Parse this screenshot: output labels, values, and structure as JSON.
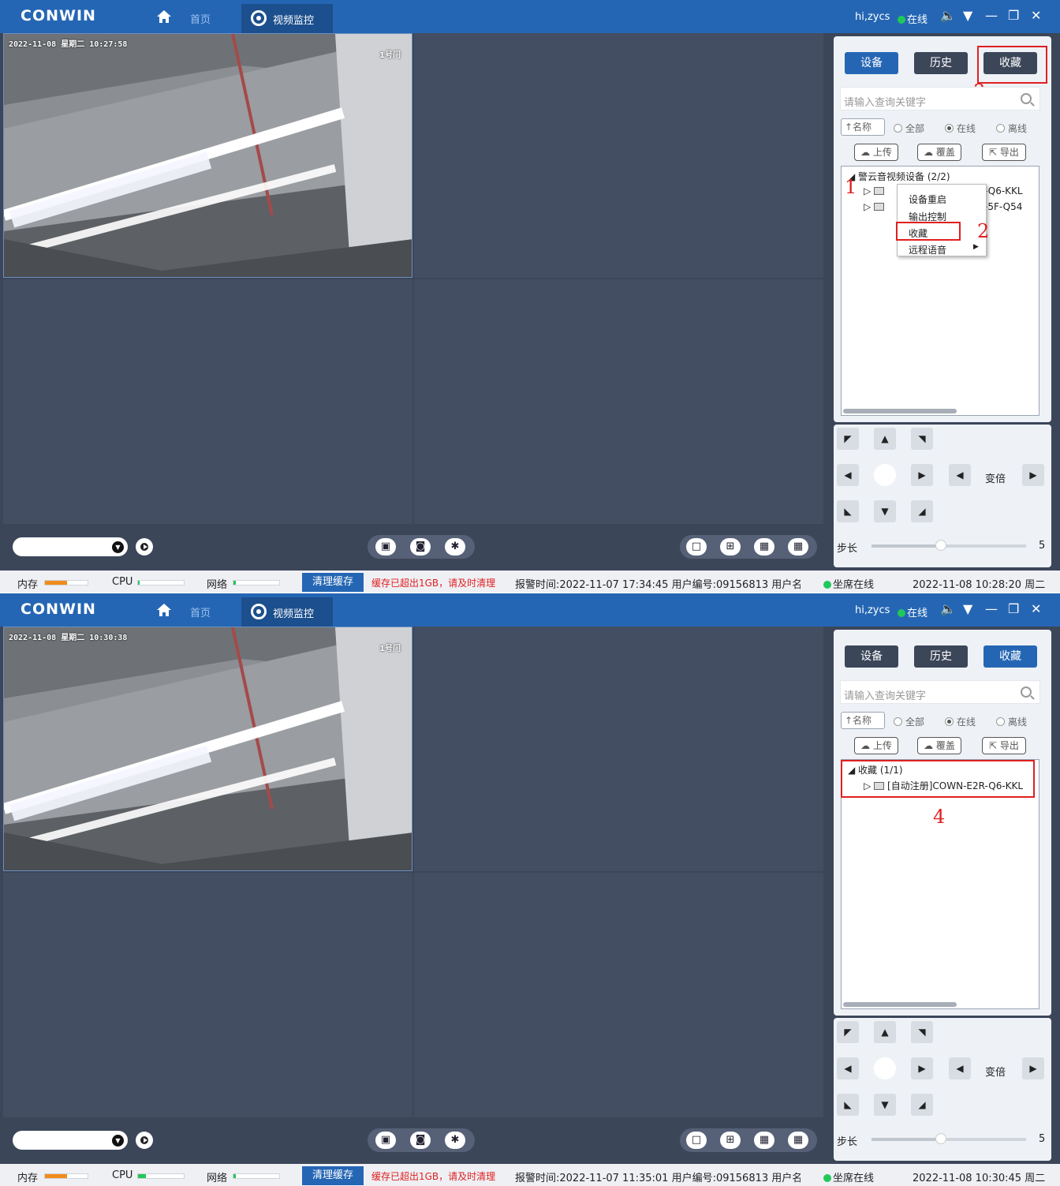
{
  "screens": [
    {
      "title": {
        "logo": "CONWIN",
        "home": "首页",
        "active_tab": "视频监控",
        "user": "hi,zycs",
        "status": "在线"
      },
      "video": {
        "osd": "2022-11-08 星期二 10:27:58",
        "osd_right": "1号门"
      },
      "panel": {
        "tabs": [
          "设备",
          "历史",
          "收藏"
        ],
        "active_tab_index": 0,
        "search_placeholder": "请输入查询关键字",
        "sort": "↑名称",
        "radios": [
          "全部",
          "在线",
          "离线"
        ],
        "radio_selected": 1,
        "actions": [
          "上传",
          "覆盖",
          "导出"
        ],
        "tree_root": "警云音视频设备 (2/2)",
        "tree_items": [
          "-Q6-KKL",
          "-5F-Q54"
        ],
        "context_menu": [
          "设备重启",
          "输出控制",
          "收藏",
          "远程语音"
        ],
        "annotations": [
          "1",
          "2",
          "3"
        ]
      },
      "ptz": {
        "zoom": "变倍",
        "step_label": "步长",
        "step_value": "5",
        "step_fraction": 0.45
      },
      "statusbar": {
        "mem": "内存",
        "cpu": "CPU",
        "net": "网络",
        "clear": "清理缓存",
        "warn": "缓存已超出1GB，请及时清理",
        "alarm": "报警时间:2022-11-07 17:34:45  用户编号:09156813  用户名",
        "seat": "坐席在线",
        "datetime": "2022-11-08 10:28:20 周二"
      }
    },
    {
      "title": {
        "logo": "CONWIN",
        "home": "首页",
        "active_tab": "视频监控",
        "user": "hi,zycs",
        "status": "在线"
      },
      "video": {
        "osd": "2022-11-08 星期二 10:30:38",
        "osd_right": "1号门"
      },
      "panel": {
        "tabs": [
          "设备",
          "历史",
          "收藏"
        ],
        "active_tab_index": 2,
        "search_placeholder": "请输入查询关键字",
        "sort": "↑名称",
        "radios": [
          "全部",
          "在线",
          "离线"
        ],
        "radio_selected": 1,
        "actions": [
          "上传",
          "覆盖",
          "导出"
        ],
        "tree_root": "收藏 (1/1)",
        "tree_items": [
          "[自动注册]COWN-E2R-Q6-KKL"
        ],
        "annotations": [
          "4"
        ]
      },
      "ptz": {
        "zoom": "变倍",
        "step_label": "步长",
        "step_value": "5",
        "step_fraction": 0.45
      },
      "statusbar": {
        "mem": "内存",
        "cpu": "CPU",
        "net": "网络",
        "clear": "清理缓存",
        "warn": "缓存已超出1GB，请及时清理",
        "alarm": "报警时间:2022-11-07 11:35:01  用户编号:09156813  用户名",
        "seat": "坐席在线",
        "datetime": "2022-11-08 10:30:45 周二"
      }
    }
  ],
  "colors": {
    "titlebar": "#2566b4",
    "video_bg": "#444e62",
    "accent_red": "#e02020",
    "online_green": "#20c85a"
  }
}
